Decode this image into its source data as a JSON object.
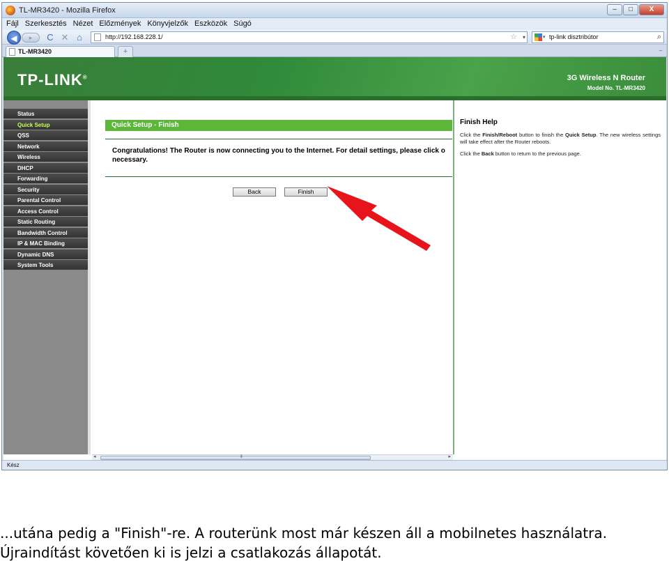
{
  "window": {
    "title": "TL-MR3420 - Mozilla Firefox",
    "controls": {
      "minimize": "–",
      "maximize": "□",
      "close": "X"
    }
  },
  "menubar": [
    "Fájl",
    "Szerkesztés",
    "Nézet",
    "Előzmények",
    "Könyvjelzők",
    "Eszközök",
    "Súgó"
  ],
  "navbar": {
    "back_glyph": "◀",
    "forward_glyph": "▸",
    "reload_glyph": "C",
    "stop_glyph": "✕",
    "home_glyph": "⌂",
    "url": "http://192.168.228.1/",
    "star_glyph": "☆",
    "dropdown_glyph": "▾",
    "search_text": "tp-link disztribútor",
    "search_glyph": "⌕"
  },
  "tabs": {
    "active_tab": "TL-MR3420",
    "new_tab_glyph": "+",
    "list_glyph": "–"
  },
  "router": {
    "logo": "TP-LINK",
    "logo_mark": "®",
    "product": "3G Wireless N Router",
    "model": "Model No. TL-MR3420",
    "menu": [
      {
        "label": "Status",
        "active": false
      },
      {
        "label": "Quick Setup",
        "active": true
      },
      {
        "label": "QSS",
        "active": false
      },
      {
        "label": "Network",
        "active": false
      },
      {
        "label": "Wireless",
        "active": false
      },
      {
        "label": "DHCP",
        "active": false
      },
      {
        "label": "Forwarding",
        "active": false
      },
      {
        "label": "Security",
        "active": false
      },
      {
        "label": "Parental Control",
        "active": false
      },
      {
        "label": "Access Control",
        "active": false
      },
      {
        "label": "Static Routing",
        "active": false
      },
      {
        "label": "Bandwidth Control",
        "active": false
      },
      {
        "label": "IP & MAC Binding",
        "active": false
      },
      {
        "label": "Dynamic DNS",
        "active": false
      },
      {
        "label": "System Tools",
        "active": false
      }
    ],
    "section_title": "Quick Setup - Finish",
    "message": "Congratulations! The Router is now connecting you to the Internet. For detail settings, please click o necessary.",
    "back_button": "Back",
    "finish_button": "Finish",
    "help": {
      "title": "Finish Help",
      "p1_a": "Click the ",
      "p1_b": "Finish/Reboot",
      "p1_c": " button to finish the ",
      "p1_d": "Quick Setup",
      "p1_e": ". The new wireless settings will take effect after the Router reboots.",
      "p2_a": "Click the ",
      "p2_b": "Back",
      "p2_c": " button to return to the previous page."
    },
    "scroll": {
      "left": "◂",
      "right": "▸",
      "grip": "⦀"
    }
  },
  "statusbar": {
    "text": "Kész"
  },
  "annotation": {
    "arrow_color": "#e8141b"
  },
  "caption": "...utána pedig a \"Finish\"-re. A routerünk most már készen áll a mobilnetes használatra. Újraindítást követően ki is jelzi a csatlakozás állapotát."
}
